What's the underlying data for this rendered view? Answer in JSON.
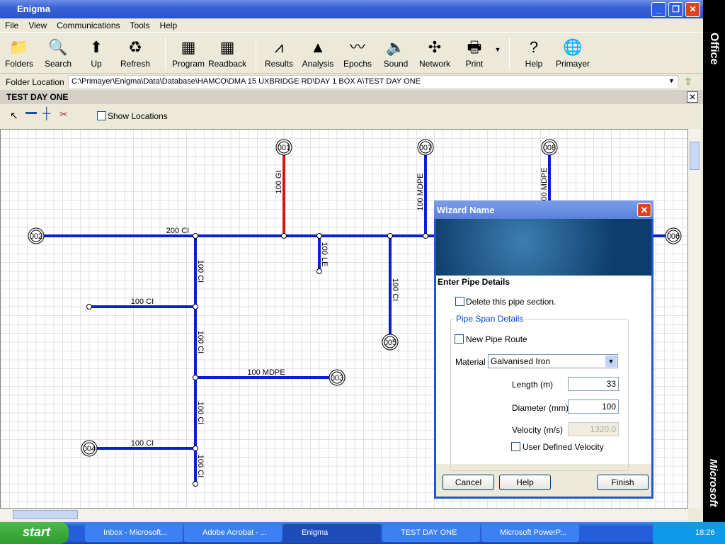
{
  "window": {
    "title": "Enigma",
    "minimize": "_",
    "maximize": "❐",
    "close": "✕"
  },
  "menu": [
    "File",
    "View",
    "Communications",
    "Tools",
    "Help"
  ],
  "toolbar": [
    {
      "label": "Folders",
      "icon": "folders-icon",
      "glyph": "📁"
    },
    {
      "label": "Search",
      "icon": "search-icon",
      "glyph": "🔍"
    },
    {
      "label": "Up",
      "icon": "up-folder-icon",
      "glyph": "⬆"
    },
    {
      "label": "Refresh",
      "icon": "refresh-icon",
      "glyph": "♻"
    },
    {
      "label": "Program",
      "icon": "program-icon",
      "glyph": "▦"
    },
    {
      "label": "Readback",
      "icon": "readback-icon",
      "glyph": "▦"
    },
    {
      "label": "Results",
      "icon": "results-icon",
      "glyph": "⩘"
    },
    {
      "label": "Analysis",
      "icon": "analysis-icon",
      "glyph": "▲"
    },
    {
      "label": "Epochs",
      "icon": "epochs-icon",
      "glyph": "〰"
    },
    {
      "label": "Sound",
      "icon": "sound-icon",
      "glyph": "🔈"
    },
    {
      "label": "Network",
      "icon": "network-icon",
      "glyph": "✣"
    },
    {
      "label": "Print",
      "icon": "print-icon",
      "glyph": "🖶"
    },
    {
      "label": "Help",
      "icon": "help-icon",
      "glyph": "?"
    },
    {
      "label": "Primayer",
      "icon": "primayer-icon",
      "glyph": "🌐"
    }
  ],
  "folder": {
    "label": "Folder Location",
    "path": "C:\\Primayer\\Enigma\\Data\\Database\\HAMCO\\DMA 15 UXBRIDGE RD\\DAY 1 BOX A\\TEST DAY ONE"
  },
  "panel": {
    "title": "TEST DAY ONE",
    "show_locations": "Show Locations"
  },
  "network": {
    "nodes": [
      "001",
      "002",
      "003",
      "004",
      "005",
      "006",
      "007",
      "008"
    ],
    "pipe_labels": [
      "200 CI",
      "100 GI",
      "100 MDPE",
      "100 MDPE",
      "100 LE",
      "100 CI",
      "100 CI",
      "100 CI",
      "100 CI",
      "100 CI",
      "100 CI",
      "100 MDPE",
      "100 CI"
    ],
    "colors": {
      "pipe": "#0a1fd0",
      "highlighted_pipe": "#e01010"
    }
  },
  "dialog": {
    "title": "Wizard Name",
    "heading": "Enter Pipe Details",
    "delete_label": "Delete this pipe section.",
    "group_label": "Pipe Span Details",
    "new_route_label": "New Pipe Route",
    "material_label": "Material",
    "material_value": "Galvanised Iron",
    "length_label": "Length (m)",
    "length_value": "33",
    "diameter_label": "Diameter (mm)",
    "diameter_value": "100",
    "velocity_label": "Velocity (m/s)",
    "velocity_value": "1320.0",
    "user_velocity_label": "User Defined Velocity",
    "cancel": "Cancel",
    "help": "Help",
    "finish": "Finish"
  },
  "officebar": {
    "top": "Office",
    "bottom": "Microsoft"
  },
  "taskbar": {
    "start": "start",
    "tasks": [
      "Inbox - Microsoft...",
      "Adobe Acrobat - ...",
      "Enigma",
      "TEST DAY ONE",
      "Microsoft PowerP..."
    ],
    "clock": "18:26"
  }
}
